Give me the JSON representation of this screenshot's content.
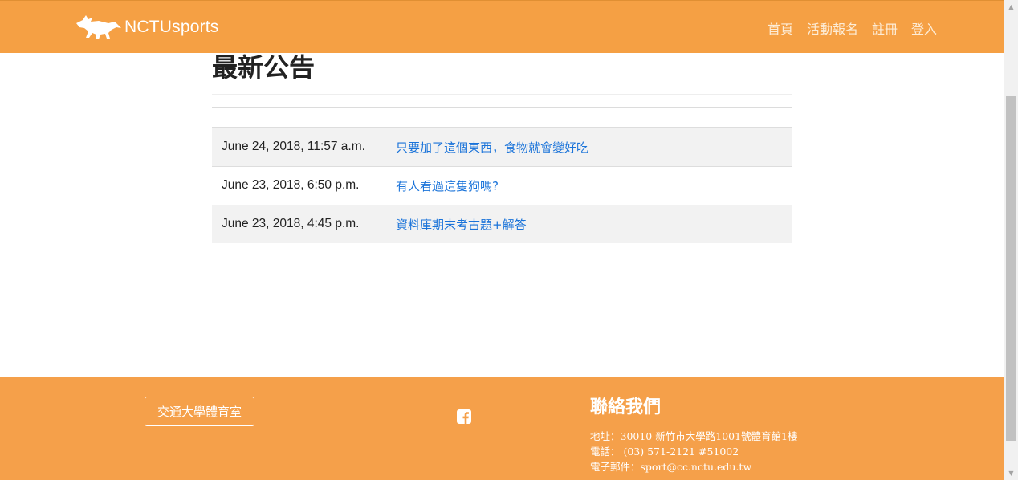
{
  "navbar": {
    "brand": "NCTUsports",
    "menu": [
      "首頁",
      "活動報名",
      "註冊",
      "登入"
    ]
  },
  "main": {
    "title": "最新公告",
    "announcements": [
      {
        "date": "June 24, 2018, 11:57 a.m.",
        "title": "只要加了這個東西，食物就會變好吃"
      },
      {
        "date": "June 23, 2018, 6:50 p.m.",
        "title": "有人看過這隻狗嗎?"
      },
      {
        "date": "June 23, 2018, 4:45 p.m.",
        "title": "資料庫期末考古題+解答"
      }
    ]
  },
  "footer": {
    "button_label": "交通大學體育室",
    "contact_title": "聯絡我們",
    "address": "地址：30010 新竹市大學路1001號體育館1樓",
    "phone": "電話： (03) 571-2121  #51002",
    "email": "電子郵件：sport@cc.nctu.edu.tw"
  },
  "colors": {
    "brand_orange": "#f5a044",
    "link_blue": "#1a73d9"
  },
  "icons": {
    "brand": "fox-logo-icon",
    "social": "facebook-icon"
  }
}
